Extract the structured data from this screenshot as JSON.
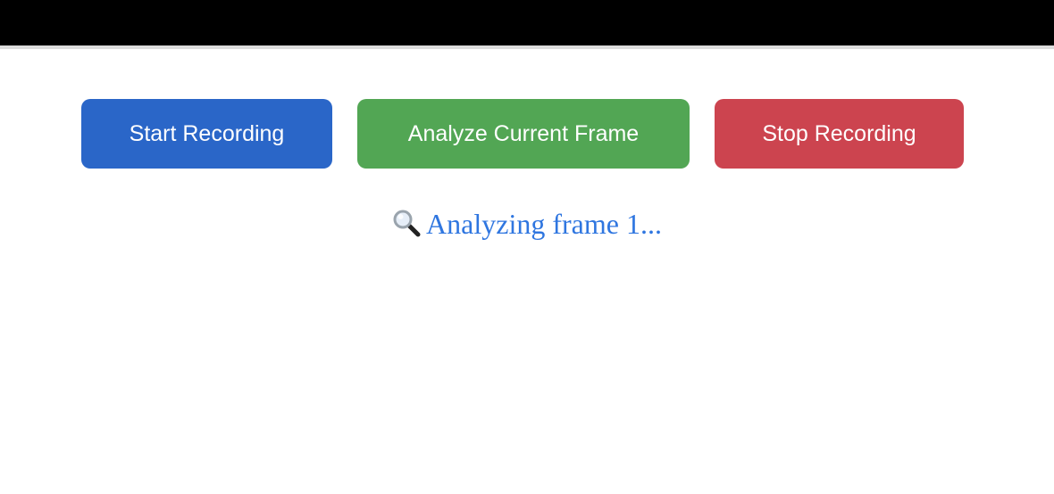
{
  "controls": {
    "start_label": "Start Recording",
    "analyze_label": "Analyze Current Frame",
    "stop_label": "Stop Recording"
  },
  "status": {
    "icon": "magnifying-glass-icon",
    "text": "Analyzing frame 1..."
  },
  "colors": {
    "start": "#2a66c8",
    "analyze": "#52a654",
    "stop": "#cc444f",
    "status_text": "#2f76e0"
  }
}
